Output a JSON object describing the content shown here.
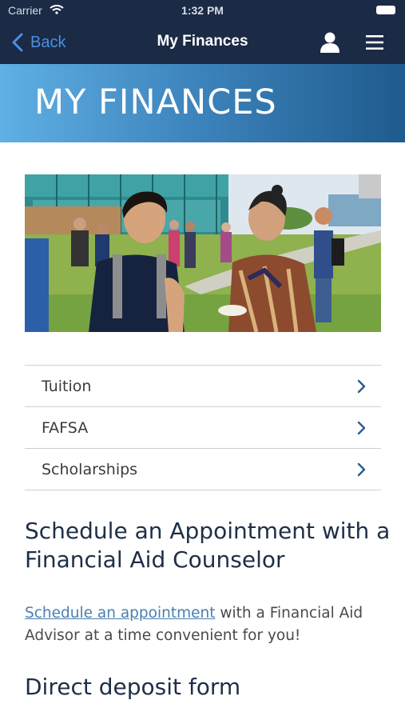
{
  "status_bar": {
    "carrier": "Carrier",
    "time": "1:32 PM"
  },
  "nav": {
    "back_label": "Back",
    "title": "My Finances",
    "accent_color": "#4a90e2",
    "bar_color": "#1b2a45"
  },
  "banner": {
    "title": "MY FINANCES"
  },
  "hero_photo": {
    "icon": "students-photo"
  },
  "links": [
    {
      "label": "Tuition"
    },
    {
      "label": "FAFSA"
    },
    {
      "label": "Scholarships"
    }
  ],
  "schedule": {
    "heading": "Schedule an Appointment with a Financial Aid Counselor",
    "link_text": "Schedule an appointment",
    "rest_text": " with a Financial Aid Advisor at a time convenient for you!"
  },
  "direct_deposit": {
    "heading": "Direct deposit form"
  }
}
